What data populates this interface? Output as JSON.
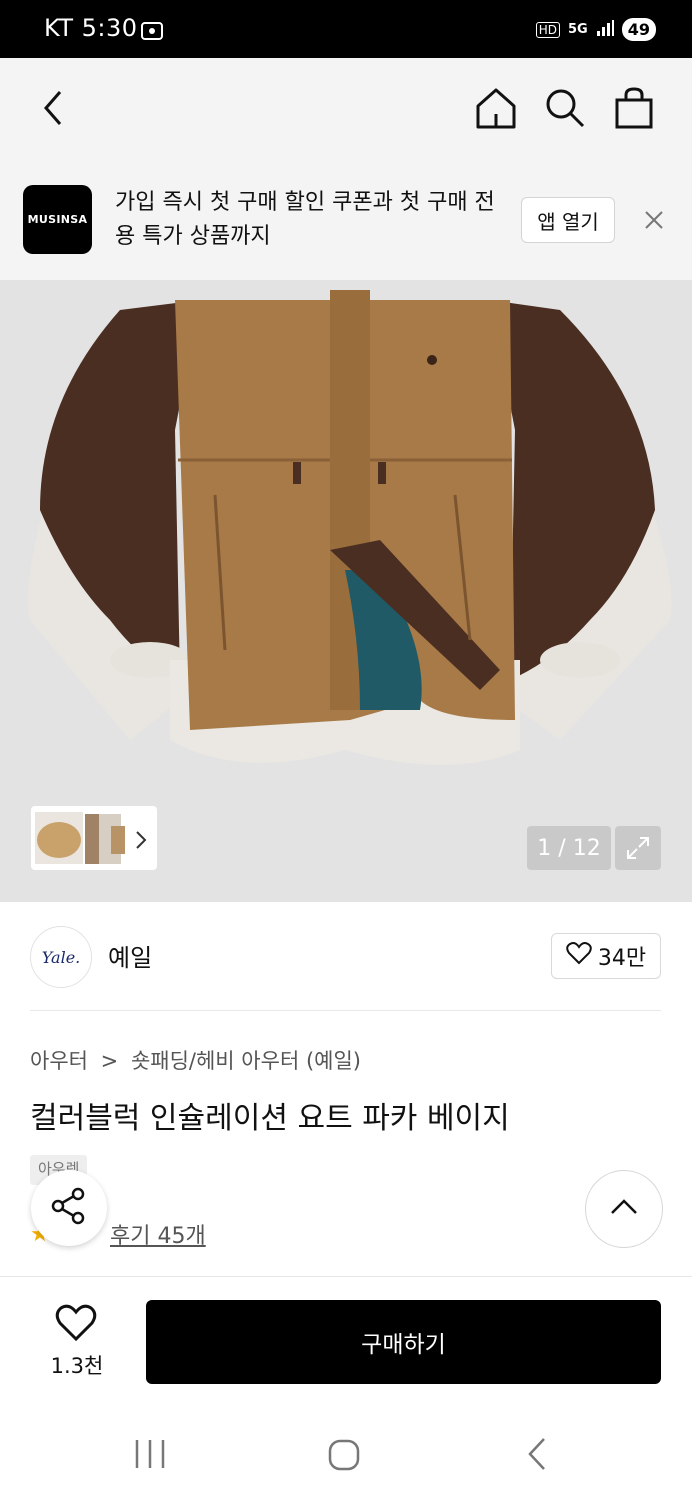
{
  "status_bar": {
    "carrier_time": "KT 5:30",
    "hd": "HD",
    "network": "5G",
    "battery": "49"
  },
  "nav": {
    "back_icon": "back-arrow-icon",
    "home_icon": "home-icon",
    "search_icon": "search-icon",
    "cart_icon": "bag-icon"
  },
  "banner": {
    "logo_text": "MUSINSA",
    "message": "가입 즉시 첫 구매 할인 쿠폰과 첫 구매 전용 특가 상품까지",
    "open_app_label": "앱 열기"
  },
  "gallery": {
    "counter": "1 / 12"
  },
  "brand": {
    "logo_text": "Yale.",
    "name": "예일",
    "likes": "34만"
  },
  "product": {
    "breadcrumb": [
      "아우터",
      "숏패딩/헤비 아우터 (예일)"
    ],
    "title": "컬러블럭 인슐레이션 요트 파카 베이지",
    "tag": "아우렛",
    "reviews": "후기 45개"
  },
  "bottom": {
    "wish_count": "1.3천",
    "buy_label": "구매하기"
  },
  "colors": {
    "accent": "#000000",
    "hero_bg": "#e3e3e3",
    "jacket_tan": "#a87a47",
    "jacket_brown": "#4a2e22"
  }
}
